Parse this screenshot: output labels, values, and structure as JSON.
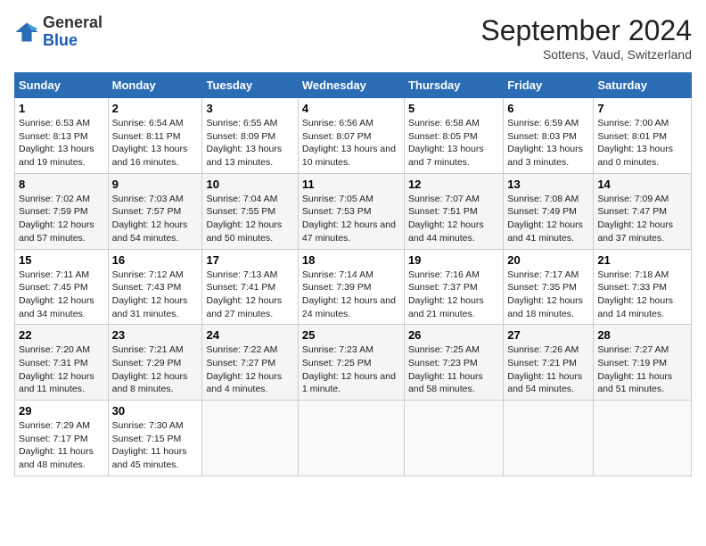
{
  "logo": {
    "general": "General",
    "blue": "Blue"
  },
  "title": "September 2024",
  "location": "Sottens, Vaud, Switzerland",
  "days_of_week": [
    "Sunday",
    "Monday",
    "Tuesday",
    "Wednesday",
    "Thursday",
    "Friday",
    "Saturday"
  ],
  "weeks": [
    [
      {
        "day": "1",
        "sunrise": "6:53 AM",
        "sunset": "8:13 PM",
        "daylight": "13 hours and 19 minutes."
      },
      {
        "day": "2",
        "sunrise": "6:54 AM",
        "sunset": "8:11 PM",
        "daylight": "13 hours and 16 minutes."
      },
      {
        "day": "3",
        "sunrise": "6:55 AM",
        "sunset": "8:09 PM",
        "daylight": "13 hours and 13 minutes."
      },
      {
        "day": "4",
        "sunrise": "6:56 AM",
        "sunset": "8:07 PM",
        "daylight": "13 hours and 10 minutes."
      },
      {
        "day": "5",
        "sunrise": "6:58 AM",
        "sunset": "8:05 PM",
        "daylight": "13 hours and 7 minutes."
      },
      {
        "day": "6",
        "sunrise": "6:59 AM",
        "sunset": "8:03 PM",
        "daylight": "13 hours and 3 minutes."
      },
      {
        "day": "7",
        "sunrise": "7:00 AM",
        "sunset": "8:01 PM",
        "daylight": "13 hours and 0 minutes."
      }
    ],
    [
      {
        "day": "8",
        "sunrise": "7:02 AM",
        "sunset": "7:59 PM",
        "daylight": "12 hours and 57 minutes."
      },
      {
        "day": "9",
        "sunrise": "7:03 AM",
        "sunset": "7:57 PM",
        "daylight": "12 hours and 54 minutes."
      },
      {
        "day": "10",
        "sunrise": "7:04 AM",
        "sunset": "7:55 PM",
        "daylight": "12 hours and 50 minutes."
      },
      {
        "day": "11",
        "sunrise": "7:05 AM",
        "sunset": "7:53 PM",
        "daylight": "12 hours and 47 minutes."
      },
      {
        "day": "12",
        "sunrise": "7:07 AM",
        "sunset": "7:51 PM",
        "daylight": "12 hours and 44 minutes."
      },
      {
        "day": "13",
        "sunrise": "7:08 AM",
        "sunset": "7:49 PM",
        "daylight": "12 hours and 41 minutes."
      },
      {
        "day": "14",
        "sunrise": "7:09 AM",
        "sunset": "7:47 PM",
        "daylight": "12 hours and 37 minutes."
      }
    ],
    [
      {
        "day": "15",
        "sunrise": "7:11 AM",
        "sunset": "7:45 PM",
        "daylight": "12 hours and 34 minutes."
      },
      {
        "day": "16",
        "sunrise": "7:12 AM",
        "sunset": "7:43 PM",
        "daylight": "12 hours and 31 minutes."
      },
      {
        "day": "17",
        "sunrise": "7:13 AM",
        "sunset": "7:41 PM",
        "daylight": "12 hours and 27 minutes."
      },
      {
        "day": "18",
        "sunrise": "7:14 AM",
        "sunset": "7:39 PM",
        "daylight": "12 hours and 24 minutes."
      },
      {
        "day": "19",
        "sunrise": "7:16 AM",
        "sunset": "7:37 PM",
        "daylight": "12 hours and 21 minutes."
      },
      {
        "day": "20",
        "sunrise": "7:17 AM",
        "sunset": "7:35 PM",
        "daylight": "12 hours and 18 minutes."
      },
      {
        "day": "21",
        "sunrise": "7:18 AM",
        "sunset": "7:33 PM",
        "daylight": "12 hours and 14 minutes."
      }
    ],
    [
      {
        "day": "22",
        "sunrise": "7:20 AM",
        "sunset": "7:31 PM",
        "daylight": "12 hours and 11 minutes."
      },
      {
        "day": "23",
        "sunrise": "7:21 AM",
        "sunset": "7:29 PM",
        "daylight": "12 hours and 8 minutes."
      },
      {
        "day": "24",
        "sunrise": "7:22 AM",
        "sunset": "7:27 PM",
        "daylight": "12 hours and 4 minutes."
      },
      {
        "day": "25",
        "sunrise": "7:23 AM",
        "sunset": "7:25 PM",
        "daylight": "12 hours and 1 minute."
      },
      {
        "day": "26",
        "sunrise": "7:25 AM",
        "sunset": "7:23 PM",
        "daylight": "11 hours and 58 minutes."
      },
      {
        "day": "27",
        "sunrise": "7:26 AM",
        "sunset": "7:21 PM",
        "daylight": "11 hours and 54 minutes."
      },
      {
        "day": "28",
        "sunrise": "7:27 AM",
        "sunset": "7:19 PM",
        "daylight": "11 hours and 51 minutes."
      }
    ],
    [
      {
        "day": "29",
        "sunrise": "7:29 AM",
        "sunset": "7:17 PM",
        "daylight": "11 hours and 48 minutes."
      },
      {
        "day": "30",
        "sunrise": "7:30 AM",
        "sunset": "7:15 PM",
        "daylight": "11 hours and 45 minutes."
      },
      null,
      null,
      null,
      null,
      null
    ]
  ]
}
